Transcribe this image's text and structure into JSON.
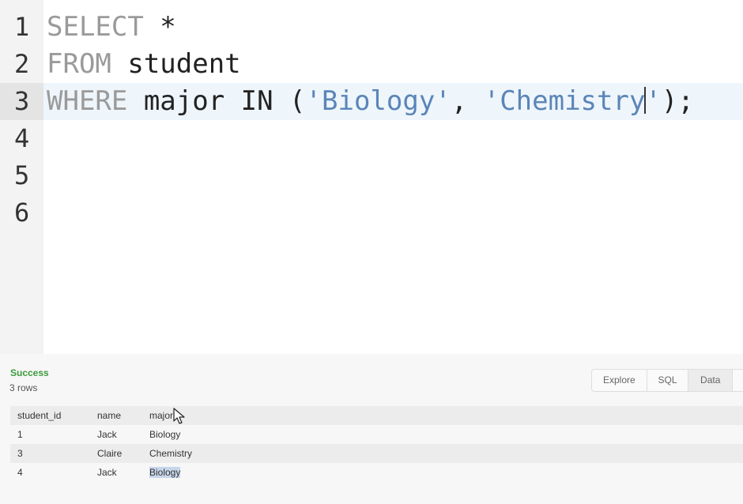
{
  "editor": {
    "line_numbers": [
      "1",
      "2",
      "3",
      "4",
      "5",
      "6"
    ],
    "active_line": 3,
    "lines": [
      {
        "keyword": "SELECT",
        "rest": " *"
      },
      {
        "keyword": "FROM",
        "rest": " student"
      },
      {
        "keyword": "WHERE",
        "middle": " major IN (",
        "string1": "'Biology'",
        "comma": ", ",
        "string2_before_cursor": "'Chemistry",
        "string2_after_cursor": "'",
        "tail": ");"
      }
    ]
  },
  "results": {
    "status": "Success",
    "row_count": "3 rows",
    "tabs": [
      "Explore",
      "SQL",
      "Data"
    ],
    "selected_tab": "Data",
    "columns": [
      "student_id",
      "name",
      "major"
    ],
    "rows": [
      [
        "1",
        "Jack",
        "Biology"
      ],
      [
        "3",
        "Claire",
        "Chemistry"
      ],
      [
        "4",
        "Jack",
        "Biology"
      ]
    ],
    "highlighted_cell": {
      "row": 2,
      "column": "major"
    }
  },
  "colors": {
    "keyword": "#9a9a9a",
    "string": "#5a85b8",
    "success": "#3a9a3a",
    "active_line": "#eef5fb",
    "selection": "#c8d6ea"
  },
  "icons": [
    "mouse-pointer-icon"
  ]
}
